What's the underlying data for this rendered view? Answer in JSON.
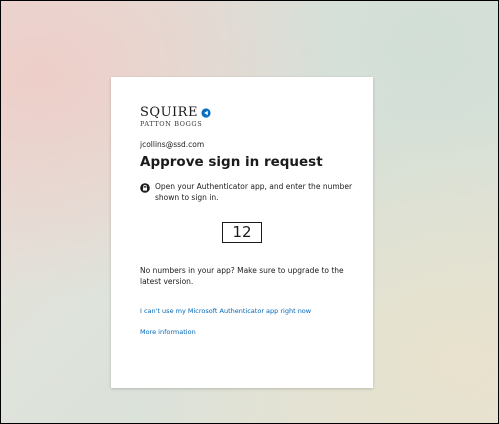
{
  "logo": {
    "name": "SQUIRE",
    "subtitle": "PATTON BOGGS",
    "mark_color": "#0a6fc2"
  },
  "account": {
    "email": "jcollins@ssd.com"
  },
  "heading": "Approve sign in request",
  "instruction": {
    "icon": "authenticator-lock-icon",
    "text": "Open your Authenticator app, and enter the number shown to sign in."
  },
  "verification_number": "12",
  "upgrade_notice": "No numbers in your app? Make sure to upgrade to the latest version.",
  "links": {
    "cant_use_app": "I can't use my Microsoft Authenticator app right now",
    "more_info": "More information"
  },
  "colors": {
    "link": "#0067b8",
    "text": "#1b1b1b",
    "card": "#ffffff"
  }
}
